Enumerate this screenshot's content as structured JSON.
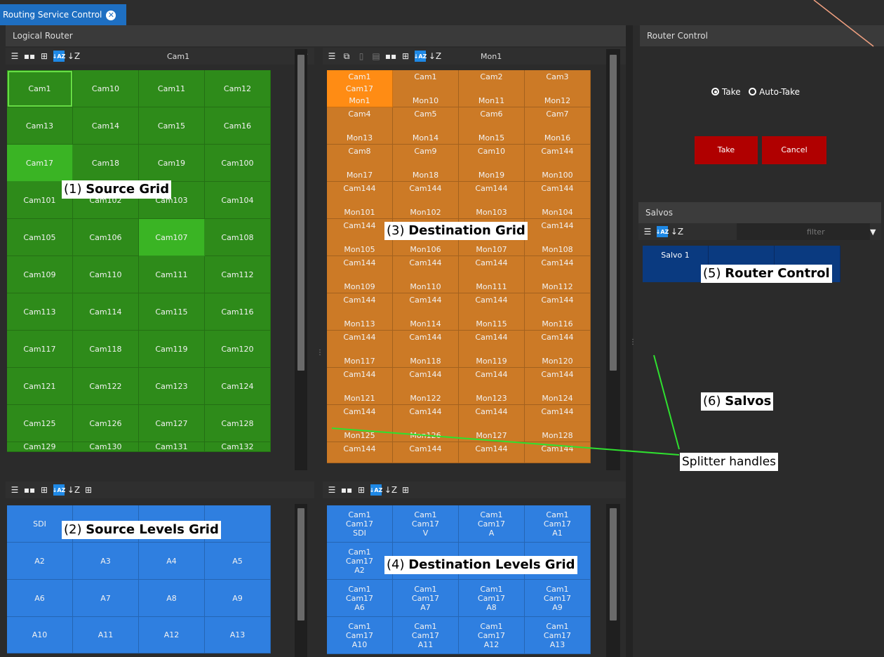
{
  "window_tab": {
    "title": "Routing Service Control"
  },
  "logical_router": {
    "title": "Logical Router"
  },
  "source_toolbar": {
    "selected": "Cam1"
  },
  "dest_toolbar": {
    "selected": "Mon1"
  },
  "source_grid": [
    "Cam1",
    "Cam10",
    "Cam11",
    "Cam12",
    "Cam13",
    "Cam14",
    "Cam15",
    "Cam16",
    "Cam17",
    "Cam18",
    "Cam19",
    "Cam100",
    "Cam101",
    "Cam102",
    "Cam103",
    "Cam104",
    "Cam105",
    "Cam106",
    "Cam107",
    "Cam108",
    "Cam109",
    "Cam110",
    "Cam111",
    "Cam112",
    "Cam113",
    "Cam114",
    "Cam115",
    "Cam116",
    "Cam117",
    "Cam118",
    "Cam119",
    "Cam120",
    "Cam121",
    "Cam122",
    "Cam123",
    "Cam124",
    "Cam125",
    "Cam126",
    "Cam127",
    "Cam128",
    "Cam129",
    "Cam130",
    "Cam131",
    "Cam132"
  ],
  "destination_grid": [
    {
      "top": "Cam1",
      "mid": "Cam17",
      "bottom": "Mon1"
    },
    {
      "top": "Cam1",
      "mid": "",
      "bottom": "Mon10"
    },
    {
      "top": "Cam2",
      "mid": "",
      "bottom": "Mon11"
    },
    {
      "top": "Cam3",
      "mid": "",
      "bottom": "Mon12"
    },
    {
      "top": "Cam4",
      "mid": "",
      "bottom": "Mon13"
    },
    {
      "top": "Cam5",
      "mid": "",
      "bottom": "Mon14"
    },
    {
      "top": "Cam6",
      "mid": "",
      "bottom": "Mon15"
    },
    {
      "top": "Cam7",
      "mid": "",
      "bottom": "Mon16"
    },
    {
      "top": "Cam8",
      "mid": "",
      "bottom": "Mon17"
    },
    {
      "top": "Cam9",
      "mid": "",
      "bottom": "Mon18"
    },
    {
      "top": "Cam10",
      "mid": "",
      "bottom": "Mon19"
    },
    {
      "top": "Cam144",
      "mid": "",
      "bottom": "Mon100"
    },
    {
      "top": "Cam144",
      "mid": "",
      "bottom": "Mon101"
    },
    {
      "top": "Cam144",
      "mid": "",
      "bottom": "Mon102"
    },
    {
      "top": "Cam144",
      "mid": "",
      "bottom": "Mon103"
    },
    {
      "top": "Cam144",
      "mid": "",
      "bottom": "Mon104"
    },
    {
      "top": "Cam144",
      "mid": "",
      "bottom": "Mon105"
    },
    {
      "top": "Cam144",
      "mid": "",
      "bottom": "Mon106"
    },
    {
      "top": "Cam144",
      "mid": "",
      "bottom": "Mon107"
    },
    {
      "top": "Cam144",
      "mid": "",
      "bottom": "Mon108"
    },
    {
      "top": "Cam144",
      "mid": "",
      "bottom": "Mon109"
    },
    {
      "top": "Cam144",
      "mid": "",
      "bottom": "Mon110"
    },
    {
      "top": "Cam144",
      "mid": "",
      "bottom": "Mon111"
    },
    {
      "top": "Cam144",
      "mid": "",
      "bottom": "Mon112"
    },
    {
      "top": "Cam144",
      "mid": "",
      "bottom": "Mon113"
    },
    {
      "top": "Cam144",
      "mid": "",
      "bottom": "Mon114"
    },
    {
      "top": "Cam144",
      "mid": "",
      "bottom": "Mon115"
    },
    {
      "top": "Cam144",
      "mid": "",
      "bottom": "Mon116"
    },
    {
      "top": "Cam144",
      "mid": "",
      "bottom": "Mon117"
    },
    {
      "top": "Cam144",
      "mid": "",
      "bottom": "Mon118"
    },
    {
      "top": "Cam144",
      "mid": "",
      "bottom": "Mon119"
    },
    {
      "top": "Cam144",
      "mid": "",
      "bottom": "Mon120"
    },
    {
      "top": "Cam144",
      "mid": "",
      "bottom": "Mon121"
    },
    {
      "top": "Cam144",
      "mid": "",
      "bottom": "Mon122"
    },
    {
      "top": "Cam144",
      "mid": "",
      "bottom": "Mon123"
    },
    {
      "top": "Cam144",
      "mid": "",
      "bottom": "Mon124"
    },
    {
      "top": "Cam144",
      "mid": "",
      "bottom": "Mon125"
    },
    {
      "top": "Cam144",
      "mid": "",
      "bottom": "Mon126"
    },
    {
      "top": "Cam144",
      "mid": "",
      "bottom": "Mon127"
    },
    {
      "top": "Cam144",
      "mid": "",
      "bottom": "Mon128"
    },
    {
      "top": "Cam144",
      "mid": "",
      "bottom": ""
    },
    {
      "top": "Cam144",
      "mid": "",
      "bottom": ""
    },
    {
      "top": "Cam144",
      "mid": "",
      "bottom": ""
    },
    {
      "top": "Cam144",
      "mid": "",
      "bottom": ""
    }
  ],
  "source_levels_grid": [
    "SDI",
    "",
    "",
    "",
    "A2",
    "A3",
    "A4",
    "A5",
    "A6",
    "A7",
    "A8",
    "A9",
    "A10",
    "A11",
    "A12",
    "A13"
  ],
  "destination_levels_grid": [
    {
      "l1": "Cam1",
      "l2": "Cam17",
      "l3": "SDI"
    },
    {
      "l1": "Cam1",
      "l2": "Cam17",
      "l3": "V"
    },
    {
      "l1": "Cam1",
      "l2": "Cam17",
      "l3": "A"
    },
    {
      "l1": "Cam1",
      "l2": "Cam17",
      "l3": "A1"
    },
    {
      "l1": "Cam1",
      "l2": "Cam17",
      "l3": "A2"
    },
    {
      "l1": "Cam1",
      "l2": "",
      "l3": ""
    },
    {
      "l1": "Cam1",
      "l2": "",
      "l3": ""
    },
    {
      "l1": "Cam1",
      "l2": "",
      "l3": ""
    },
    {
      "l1": "Cam1",
      "l2": "Cam17",
      "l3": "A6"
    },
    {
      "l1": "Cam1",
      "l2": "Cam17",
      "l3": "A7"
    },
    {
      "l1": "Cam1",
      "l2": "Cam17",
      "l3": "A8"
    },
    {
      "l1": "Cam1",
      "l2": "Cam17",
      "l3": "A9"
    },
    {
      "l1": "Cam1",
      "l2": "Cam17",
      "l3": "A10"
    },
    {
      "l1": "Cam1",
      "l2": "Cam17",
      "l3": "A11"
    },
    {
      "l1": "Cam1",
      "l2": "Cam17",
      "l3": "A12"
    },
    {
      "l1": "Cam1",
      "l2": "Cam17",
      "l3": "A13"
    }
  ],
  "router_control": {
    "title": "Router Control",
    "radio_take": "Take",
    "radio_auto_take": "Auto-Take",
    "take_button": "Take",
    "cancel_button": "Cancel"
  },
  "salvos": {
    "title": "Salvos",
    "filter_placeholder": "filter",
    "items": [
      "Salvo 1",
      "",
      ""
    ]
  },
  "callouts": {
    "source_grid_num": "(1) ",
    "source_grid": "Source Grid",
    "source_levels_num": "(2) ",
    "source_levels": "Source Levels Grid",
    "destination_grid_num": "(3) ",
    "destination_grid": "Destination Grid",
    "destination_levels_num": "(4) ",
    "destination_levels": "Destination Levels Grid",
    "router_control_num": "(5) ",
    "router_control": "Router Control",
    "salvos_num": "(6) ",
    "salvos": "Salvos",
    "splitter_handles": "Splitter handles"
  },
  "colors": {
    "source": "#2e8b1a",
    "source_selected": "#3ab424",
    "destination": "#cc7a26",
    "destination_selected": "#ff8c14",
    "levels": "#2f7fe0",
    "tab": "#1e6fc2",
    "take_red": "#b00000",
    "salvo": "#0a3a80",
    "annotation_line": "#2fe02f",
    "annotation_arrow": "#f0a080"
  }
}
